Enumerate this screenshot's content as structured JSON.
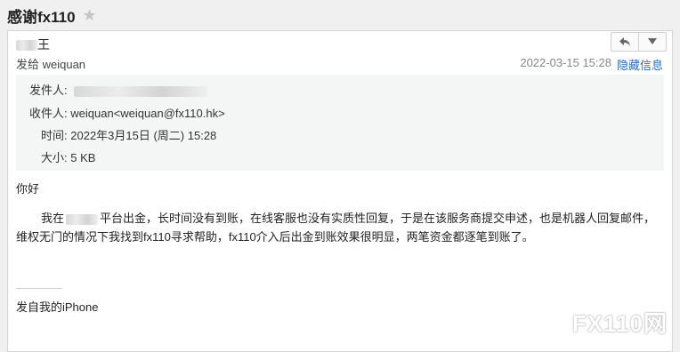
{
  "subject": "感谢fx110",
  "icons": {
    "star": "star-icon",
    "reply": "reply-icon",
    "more": "chevron-down-icon"
  },
  "header": {
    "sender_visible_fragment": "王",
    "send_to": "发给 weiquan",
    "datetime": "2022-03-15 15:28",
    "hide_info": "隐藏信息"
  },
  "details": {
    "from_label": "发件人:",
    "to_label": "收件人:",
    "to_value": "weiquan<weiquan@fx110.hk>",
    "time_label": "时间:",
    "time_value": "2022年3月15日 (周二) 15:28",
    "size_label": "大小:",
    "size_value": "5 KB"
  },
  "body": {
    "greeting": "你好",
    "p_start": "我在",
    "p_rest": "平台出金，长时间没有到账，在线客服也没有实质性回复，于是在该服务商提交申述，也是机器人回复邮件，维权无门的情况下我找到fx110寻求帮助，fx110介入后出金到账效果很明显，两笔资金都逐笔到账了。",
    "signature": "发自我的iPhone"
  },
  "watermark": "FX110网",
  "colors": {
    "link": "#2a6bc4",
    "details_bg": "#f4f6f6",
    "page_bg": "#f0f0f0"
  }
}
